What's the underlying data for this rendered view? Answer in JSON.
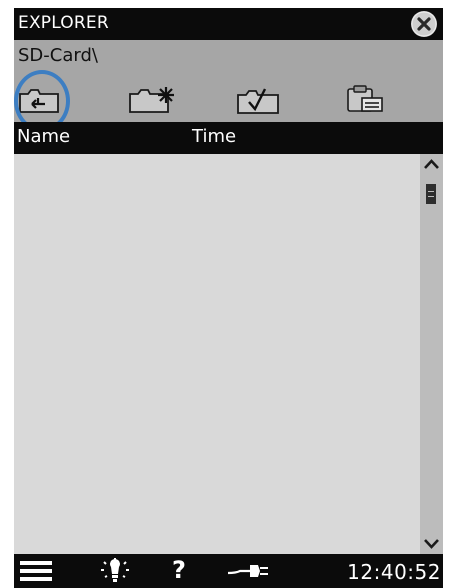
{
  "window": {
    "title": "EXPLORER",
    "close_icon": "close-icon"
  },
  "path": {
    "current": "SD-Card\\"
  },
  "toolbar": {
    "items": [
      {
        "icon": "folder-up-icon"
      },
      {
        "icon": "new-folder-icon"
      },
      {
        "icon": "folder-check-icon"
      },
      {
        "icon": "clipboard-paste-icon"
      }
    ],
    "highlight_color": "#3d7ec2"
  },
  "columns": {
    "name": "Name",
    "time": "Time"
  },
  "files": [],
  "statusbar": {
    "menu_icon": "menu-icon",
    "backlight_icon": "backlight-icon",
    "help_icon": "help-icon",
    "power_icon": "power-plug-icon",
    "help_glyph": "?",
    "time": "12:40:52"
  },
  "colors": {
    "bar_black": "#0b0b0b",
    "toolbar_gray": "#a6a6a6",
    "list_bg": "#d9d9d9"
  }
}
